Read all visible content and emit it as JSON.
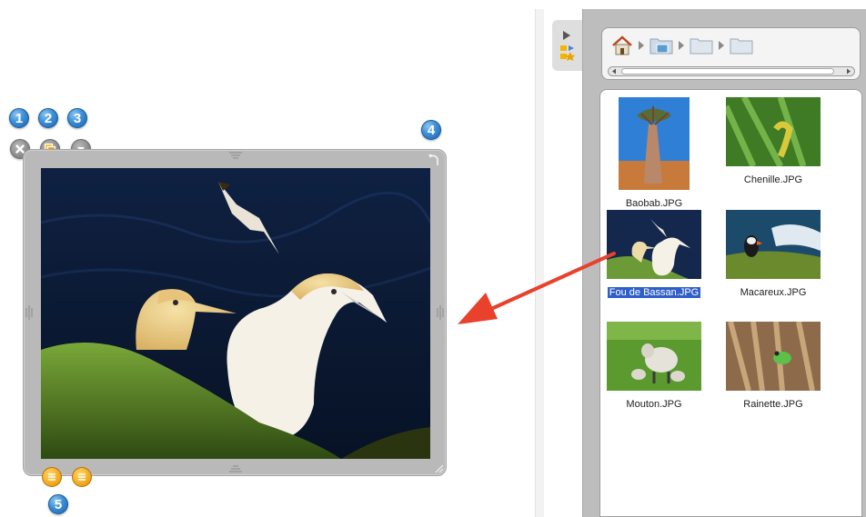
{
  "badges": [
    "1",
    "2",
    "3",
    "4",
    "5"
  ],
  "files": [
    {
      "name": "Baobab.JPG"
    },
    {
      "name": "Chenille.JPG"
    },
    {
      "name": "Fou de Bassan.JPG",
      "selected": true
    },
    {
      "name": "Macareux.JPG"
    },
    {
      "name": "Mouton.JPG"
    },
    {
      "name": "Rainette.JPG"
    }
  ],
  "icons": {
    "close": "close-icon",
    "duplicate": "duplicate-icon",
    "menu": "chevron-down-icon",
    "rotate": "rotate-icon",
    "resize": "resize-grip-icon",
    "home": "home-icon",
    "folder": "folder-icon",
    "tray": "list-icon"
  },
  "colors": {
    "badge": "#3b8fd6",
    "arrow": "#e8412c",
    "selection": "#2f5fc8",
    "frame": "#b9b9b9",
    "panel": "#bdbdbd"
  }
}
